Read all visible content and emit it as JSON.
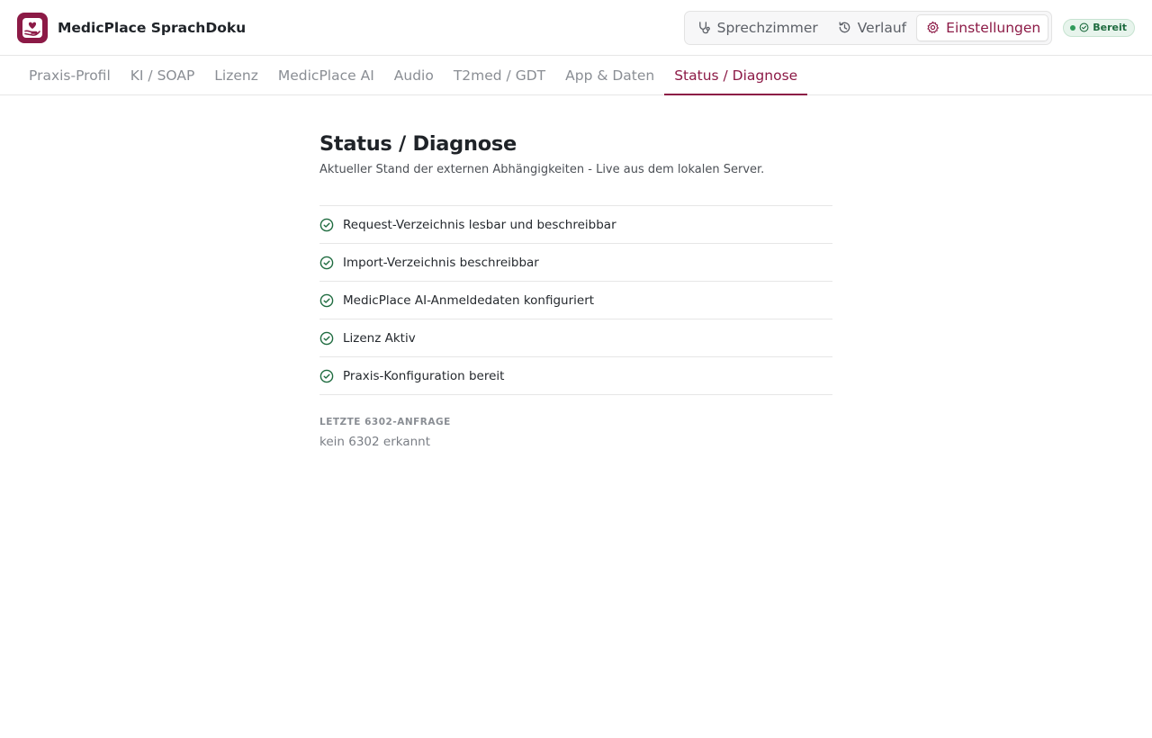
{
  "app": {
    "title": "MedicPlace SprachDoku"
  },
  "nav": [
    {
      "label": "Sprechzimmer",
      "icon": "stethoscope-icon",
      "active": false
    },
    {
      "label": "Verlauf",
      "icon": "history-icon",
      "active": false
    },
    {
      "label": "Einstellungen",
      "icon": "gear-icon",
      "active": true
    }
  ],
  "status_badge": {
    "label": "Bereit",
    "color": "#2f9a5a"
  },
  "tabs": [
    {
      "label": "Praxis-Profil",
      "active": false
    },
    {
      "label": "KI / SOAP",
      "active": false
    },
    {
      "label": "Lizenz",
      "active": false
    },
    {
      "label": "MedicPlace AI",
      "active": false
    },
    {
      "label": "Audio",
      "active": false
    },
    {
      "label": "T2med / GDT",
      "active": false
    },
    {
      "label": "App & Daten",
      "active": false
    },
    {
      "label": "Status / Diagnose",
      "active": true
    }
  ],
  "page": {
    "title": "Status / Diagnose",
    "subtitle": "Aktueller Stand der externen Abhängigkeiten - Live aus dem lokalen Server."
  },
  "checks": [
    {
      "label": "Request-Verzeichnis lesbar und beschreibbar",
      "status": "ok"
    },
    {
      "label": "Import-Verzeichnis beschreibbar",
      "status": "ok"
    },
    {
      "label": "MedicPlace AI-Anmeldedaten konfiguriert",
      "status": "ok"
    },
    {
      "label": "Lizenz Aktiv",
      "status": "ok"
    },
    {
      "label": "Praxis-Konfiguration bereit",
      "status": "ok"
    }
  ],
  "last_request": {
    "label": "LETZTE 6302-ANFRAGE",
    "value": "kein 6302 erkannt"
  },
  "colors": {
    "accent": "#8c1a46",
    "success": "#1e6b3f"
  }
}
